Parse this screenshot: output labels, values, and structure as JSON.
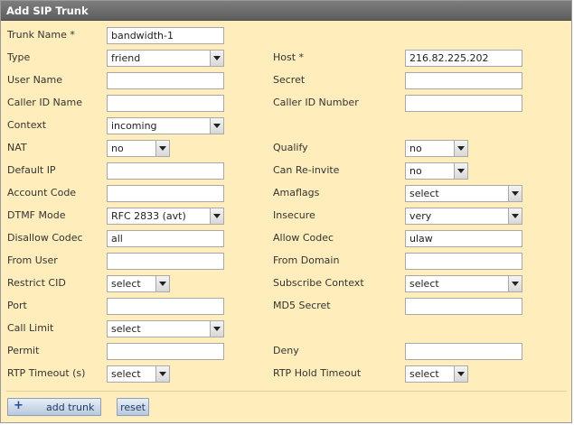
{
  "panel": {
    "title": "Add SIP Trunk"
  },
  "left": [
    {
      "label": "Trunk Name *",
      "kind": "input",
      "value": "bandwidth-1"
    },
    {
      "label": "Type",
      "kind": "select",
      "value": "friend"
    },
    {
      "label": "User Name",
      "kind": "input",
      "value": ""
    },
    {
      "label": "Caller ID Name",
      "kind": "input",
      "value": ""
    },
    {
      "label": "Context",
      "kind": "select",
      "value": "incoming"
    },
    {
      "label": "NAT",
      "kind": "select",
      "value": "no"
    },
    {
      "label": "Default IP",
      "kind": "input",
      "value": ""
    },
    {
      "label": "Account Code",
      "kind": "input",
      "value": ""
    },
    {
      "label": "DTMF Mode",
      "kind": "select",
      "value": "RFC 2833 (avt)"
    },
    {
      "label": "Disallow Codec",
      "kind": "input",
      "value": "all"
    },
    {
      "label": "From User",
      "kind": "input",
      "value": ""
    },
    {
      "label": "Restrict CID",
      "kind": "select",
      "value": "select"
    },
    {
      "label": "Port",
      "kind": "input",
      "value": ""
    },
    {
      "label": "Call Limit",
      "kind": "select",
      "value": "select"
    },
    {
      "label": "Permit",
      "kind": "input",
      "value": ""
    },
    {
      "label": "RTP Timeout (s)",
      "kind": "select",
      "value": "select"
    }
  ],
  "right": [
    null,
    {
      "label": "Host *",
      "kind": "input",
      "value": "216.82.225.202"
    },
    {
      "label": "Secret",
      "kind": "input",
      "value": ""
    },
    {
      "label": "Caller ID Number",
      "kind": "input",
      "value": ""
    },
    null,
    {
      "label": "Qualify",
      "kind": "select",
      "value": "no"
    },
    {
      "label": "Can Re-invite",
      "kind": "select",
      "value": "no"
    },
    {
      "label": "Amaflags",
      "kind": "select",
      "value": "select"
    },
    {
      "label": "Insecure",
      "kind": "select",
      "value": "very"
    },
    {
      "label": "Allow Codec",
      "kind": "input",
      "value": "ulaw"
    },
    {
      "label": "From Domain",
      "kind": "input",
      "value": ""
    },
    {
      "label": "Subscribe Context",
      "kind": "select",
      "value": "select"
    },
    {
      "label": "MD5 Secret",
      "kind": "input",
      "value": ""
    },
    null,
    {
      "label": "Deny",
      "kind": "input",
      "value": ""
    },
    {
      "label": "RTP Hold Timeout",
      "kind": "select",
      "value": "select"
    }
  ],
  "buttons": {
    "add": "add trunk",
    "reset": "reset"
  }
}
